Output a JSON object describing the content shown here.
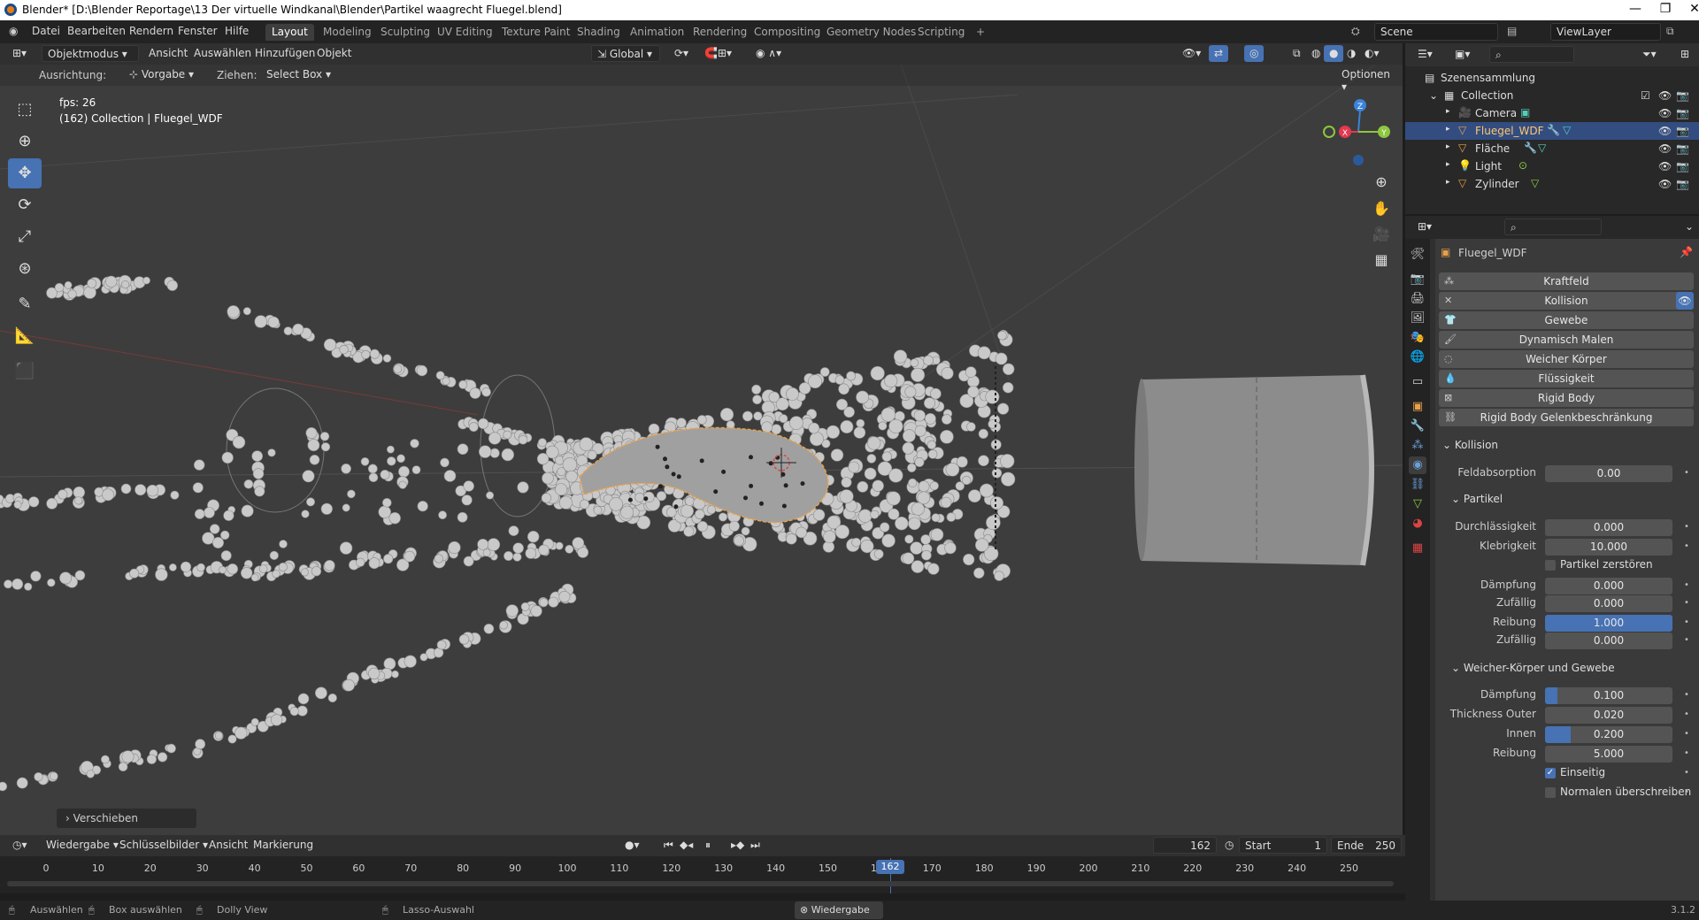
{
  "window": {
    "title": "Blender* [D:\\Blender Reportage\\13 Der virtuelle Windkanal\\Blender\\Partikel waagrecht Fluegel.blend]"
  },
  "topbar": {
    "menus": [
      "Datei",
      "Bearbeiten",
      "Rendern",
      "Fenster",
      "Hilfe"
    ],
    "workspaces": [
      "Layout",
      "Modeling",
      "Sculpting",
      "UV Editing",
      "Texture Paint",
      "Shading",
      "Animation",
      "Rendering",
      "Compositing",
      "Geometry Nodes",
      "Scripting"
    ],
    "active_workspace": "Layout",
    "add_tab": "+",
    "scene": "Scene",
    "view_layer": "ViewLayer"
  },
  "viewport": {
    "mode": "Objektmodus",
    "menus": [
      "Ansicht",
      "Auswählen",
      "Hinzufügen",
      "Objekt"
    ],
    "orientation_value": "Global",
    "tool_label_orient": "Ausrichtung:",
    "tool_orient_value": "Vorgabe",
    "tool_label_drag": "Ziehen:",
    "tool_drag_value": "Select Box",
    "options": "Optionen",
    "fps": "fps: 26",
    "info": "(162) Collection | Fluegel_WDF",
    "last_op": "Verschieben",
    "gizmo": {
      "z": "Z",
      "x": "X",
      "y": "Y"
    }
  },
  "outliner": {
    "root": "Szenensammlung",
    "collection": "Collection",
    "items": [
      {
        "name": "Camera"
      },
      {
        "name": "Fluegel_WDF",
        "selected": true
      },
      {
        "name": "Fläche"
      },
      {
        "name": "Light"
      },
      {
        "name": "Zylinder"
      }
    ]
  },
  "properties": {
    "object_name": "Fluegel_WDF",
    "physics_buttons": [
      "Kraftfeld",
      "Kollision",
      "Gewebe",
      "Dynamisch Malen",
      "Weicher Körper",
      "Flüssigkeit",
      "Rigid Body",
      "Rigid Body Gelenkbeschränkung"
    ],
    "collision_section": "Kollision",
    "feldabsorption_label": "Feldabsorption",
    "feldabsorption": "0.00",
    "partikel_section": "Partikel",
    "durchlaessigkeit_label": "Durchlässigkeit",
    "durchlaessigkeit": "0.000",
    "klebrigkeit_label": "Klebrigkeit",
    "klebrigkeit": "10.000",
    "partikel_zerstoeren": "Partikel zerstören",
    "daempfung_label": "Dämpfung",
    "daempfung": "0.000",
    "zufaellig_label": "Zufällig",
    "zufaellig1": "0.000",
    "reibung_label": "Reibung",
    "reibung": "1.000",
    "zufaellig2": "0.000",
    "softbody_section": "Weicher-Körper und Gewebe",
    "sb_daempfung": "0.100",
    "sb_daempfung_fill": 0.1,
    "thickness_outer_label": "Thickness Outer",
    "thickness_outer": "0.020",
    "innen_label": "Innen",
    "innen": "0.200",
    "innen_fill": 0.2,
    "sb_reibung": "5.000",
    "einseitig": "Einseitig",
    "normalen": "Normalen überschreiben"
  },
  "timeline": {
    "menus": [
      "Wiedergabe",
      "Schlüsselbilder",
      "Ansicht",
      "Markierung"
    ],
    "current_frame": "162",
    "start_label": "Start",
    "start": "1",
    "end_label": "Ende",
    "end": "250",
    "ticks": [
      "0",
      "10",
      "20",
      "30",
      "40",
      "50",
      "60",
      "70",
      "80",
      "90",
      "100",
      "110",
      "120",
      "130",
      "140",
      "150",
      "160",
      "170",
      "180",
      "190",
      "200",
      "210",
      "220",
      "230",
      "240",
      "250"
    ],
    "playhead_label": "162"
  },
  "statusbar": {
    "items": [
      "Auswählen",
      "Box auswählen",
      "Dolly View",
      "Lasso-Auswahl"
    ],
    "center": "Wiedergabe",
    "version": "3.1.2"
  },
  "colors": {
    "accent": "#4772b3",
    "selection_orange": "#e8a04a",
    "axis_x": "#e2394f",
    "axis_y": "#8ec63f",
    "axis_z": "#3b83d9"
  }
}
